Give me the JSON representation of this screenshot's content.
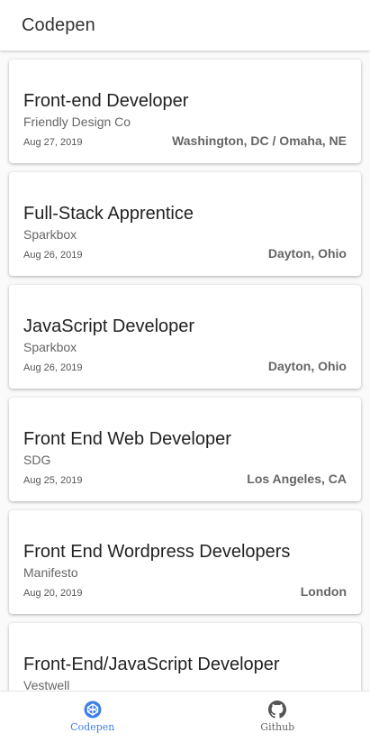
{
  "app": {
    "title": "Codepen"
  },
  "jobs": [
    {
      "title": "Front-end Developer",
      "company": "Friendly Design Co",
      "date": "Aug 27, 2019",
      "location": "Washington, DC / Omaha, NE"
    },
    {
      "title": "Full-Stack Apprentice",
      "company": "Sparkbox",
      "date": "Aug 26, 2019",
      "location": "Dayton, Ohio"
    },
    {
      "title": "JavaScript Developer",
      "company": "Sparkbox",
      "date": "Aug 26, 2019",
      "location": "Dayton, Ohio"
    },
    {
      "title": "Front End Web Developer",
      "company": "SDG",
      "date": "Aug 25, 2019",
      "location": "Los Angeles, CA"
    },
    {
      "title": "Front End Wordpress Developers",
      "company": "Manifesto",
      "date": "Aug 20, 2019",
      "location": "London"
    },
    {
      "title": "Front-End/JavaScript Developer",
      "company": "Vestwell",
      "date": "",
      "location": ""
    }
  ],
  "bottom_nav": {
    "items": [
      {
        "label": "Codepen",
        "icon": "codepen-icon",
        "active": true
      },
      {
        "label": "Github",
        "icon": "github-icon",
        "active": false
      }
    ]
  },
  "colors": {
    "accent": "#3f7fe8",
    "text": "#212121",
    "muted": "#666666"
  }
}
